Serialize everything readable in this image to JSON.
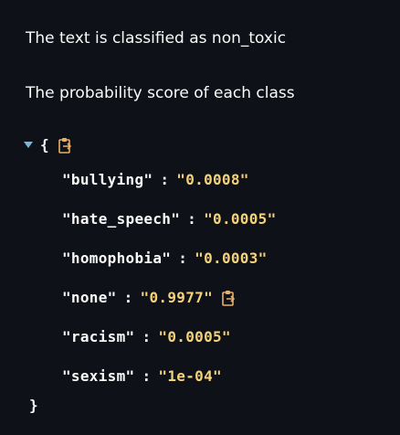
{
  "result": {
    "text": "The text is classified as non_toxic"
  },
  "probabilities": {
    "heading": "The probability score of each class",
    "open_brace": "{",
    "close_brace": "}",
    "entries": [
      {
        "key": "\"bullying\"",
        "value": "\"0.0008\""
      },
      {
        "key": "\"hate_speech\"",
        "value": "\"0.0005\""
      },
      {
        "key": "\"homophobia\"",
        "value": "\"0.0003\""
      },
      {
        "key": "\"none\"",
        "value": "\"0.9977\""
      },
      {
        "key": "\"racism\"",
        "value": "\"0.0005\""
      },
      {
        "key": "\"sexism\"",
        "value": "\"1e-04\""
      }
    ],
    "colon": ":"
  },
  "icons": {
    "toggle": "collapse-arrow-icon",
    "copy": "clipboard-copy-icon"
  },
  "colors": {
    "background": "#0e1117",
    "text": "#fafafa",
    "string_value": "#f4d27a",
    "toggle": "#79b8d6",
    "copy_icon": "#e8b06a"
  }
}
